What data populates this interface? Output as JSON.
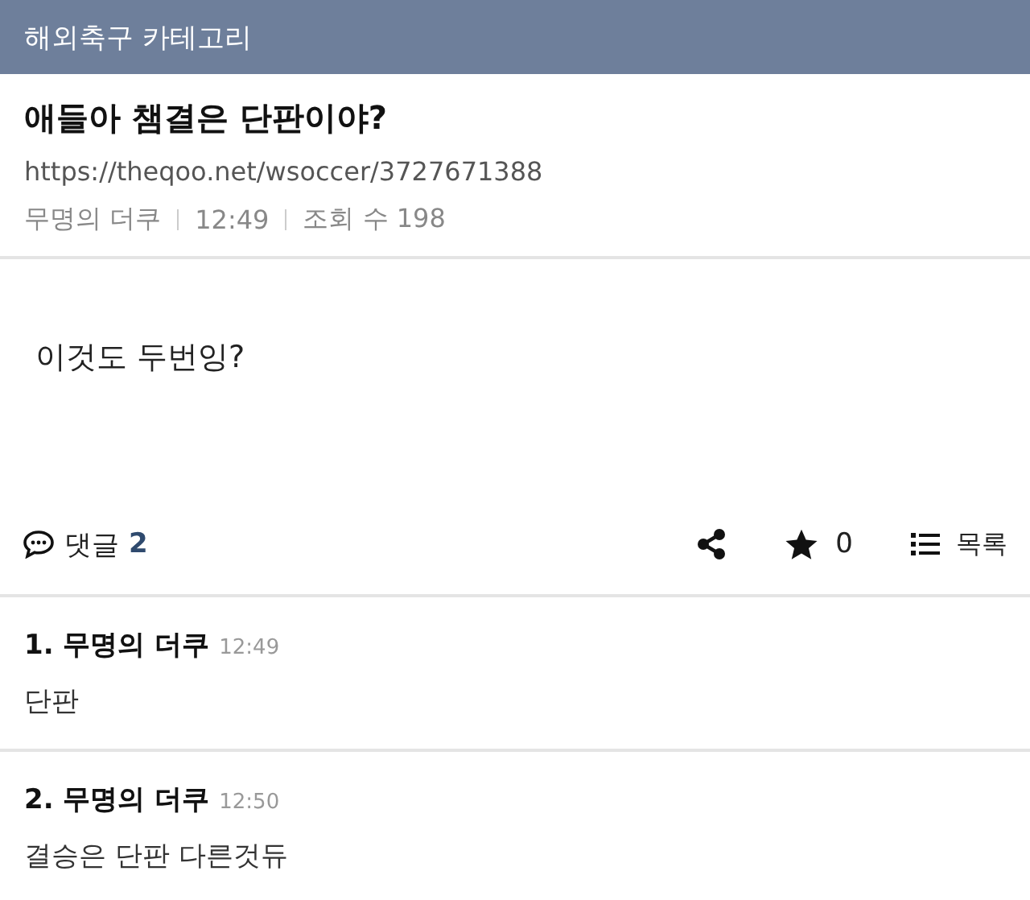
{
  "header": {
    "category": "해외축구 카테고리"
  },
  "post": {
    "title": "애들아 챔결은 단판이야?",
    "url": "https://theqoo.net/wsoccer/3727671388",
    "author": "무명의 더쿠",
    "time": "12:49",
    "views": "조회 수 198",
    "body": "이것도 두번잉?"
  },
  "actions": {
    "comments_label": "댓글",
    "comments_count": "2",
    "star_count": "0",
    "list_label": "목록"
  },
  "comments": [
    {
      "number": "1.",
      "author": "무명의 더쿠",
      "time": "12:49",
      "text": "단판"
    },
    {
      "number": "2.",
      "author": "무명의 더쿠",
      "time": "12:50",
      "text": "결승은 단판 다른것듀"
    }
  ]
}
